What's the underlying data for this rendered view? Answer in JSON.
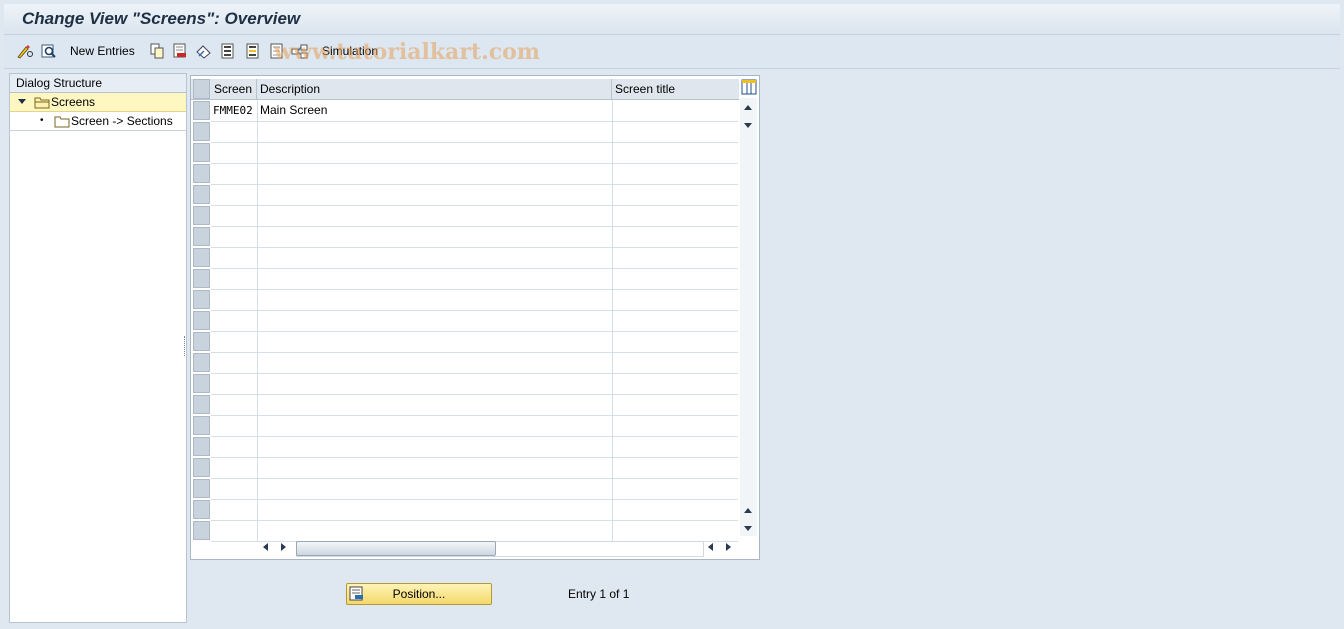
{
  "window": {
    "title": "Change View \"Screens\": Overview"
  },
  "toolbar": {
    "icons": [
      "pencil-glasses-icon",
      "display-change-icon",
      "copy-icon",
      "delete-icon",
      "undo-icon",
      "select-all-icon",
      "select-block-icon",
      "deselect-icon",
      "simulation-icon"
    ],
    "new_entries_label": "New Entries",
    "simulation_label": "Simulation",
    "watermark": "www.tutorialkart.com"
  },
  "dialog_structure": {
    "title": "Dialog Structure",
    "items": [
      {
        "label": "Screens",
        "selected": true,
        "level": 1,
        "icon": "folder-open-icon"
      },
      {
        "label": "Screen -> Sections",
        "selected": false,
        "level": 2,
        "icon": "folder-icon"
      }
    ]
  },
  "table": {
    "columns": [
      "Screen",
      "Description",
      "Screen title"
    ],
    "rows": [
      {
        "screen": "FMME02",
        "description": "Main Screen",
        "title": ""
      }
    ],
    "empty_rows": 20
  },
  "footer": {
    "position_button": "Position...",
    "entry_text": "Entry 1 of 1"
  },
  "colors": {
    "background": "#dfe8f1",
    "selected_node": "#fff7c2",
    "button": "#f4d86a"
  }
}
